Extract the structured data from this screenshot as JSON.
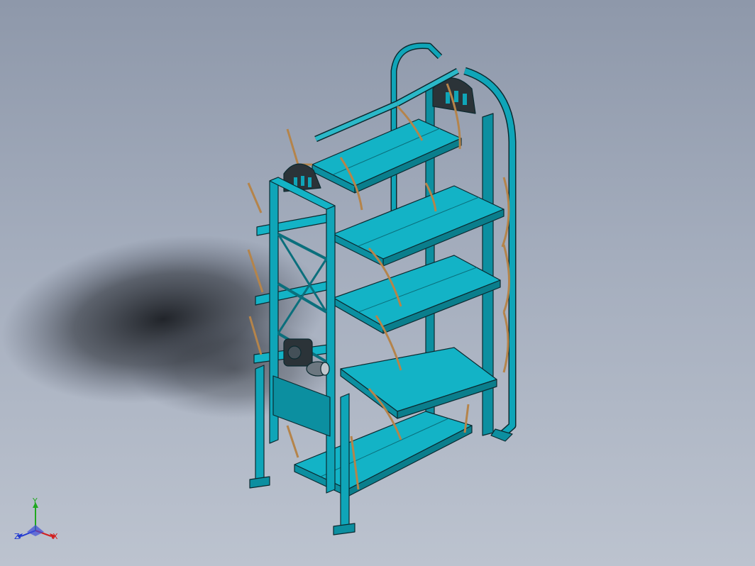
{
  "viewport": {
    "background_top": "#8e98aa",
    "background_bottom": "#bcc3cf"
  },
  "model": {
    "body_color": "#0fa5b8",
    "edge_color": "#0b2a30",
    "hanger_color": "#b5844a",
    "dark_part_color": "#2b3338"
  },
  "triad": {
    "x_label": "X",
    "y_label": "Y",
    "z_label": "Z",
    "x_color": "#d22020",
    "y_color": "#1fa81f",
    "z_color": "#2038d0"
  }
}
